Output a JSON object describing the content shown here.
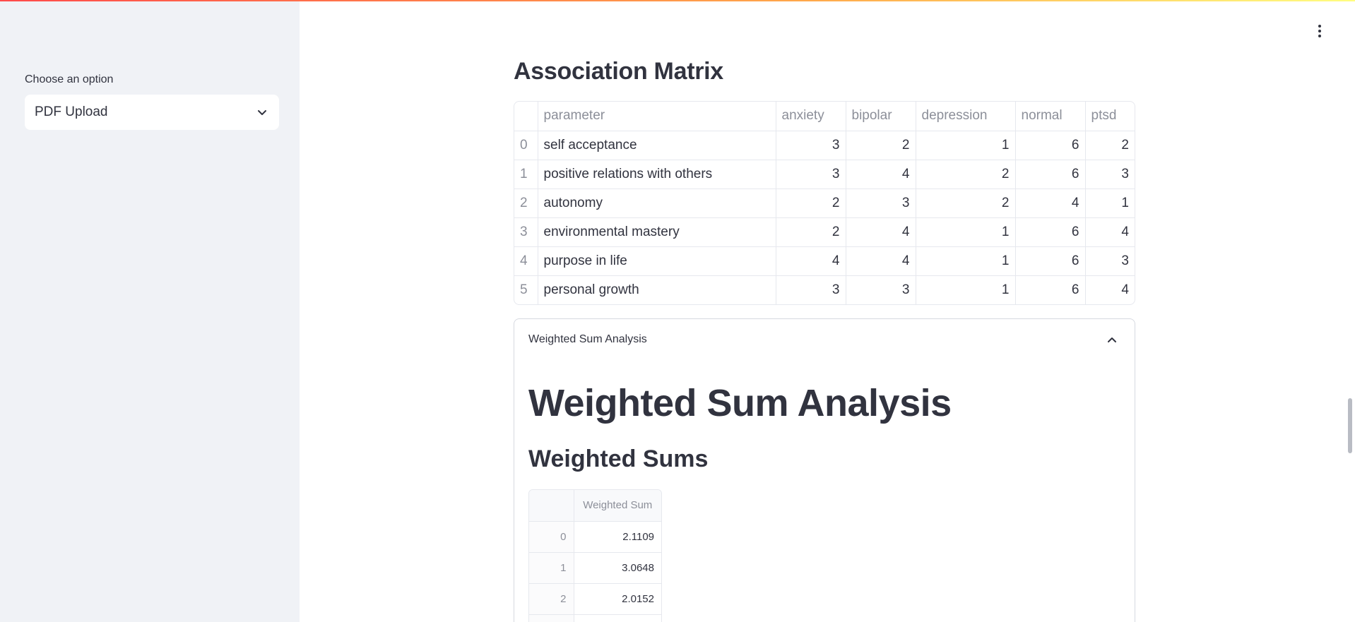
{
  "sidebar": {
    "label": "Choose an option",
    "select_value": "PDF Upload"
  },
  "main": {
    "association_title": "Association Matrix",
    "matrix": {
      "columns": [
        "",
        "parameter",
        "anxiety",
        "bipolar",
        "depression",
        "normal",
        "ptsd"
      ],
      "rows": [
        {
          "idx": "0",
          "parameter": "self acceptance",
          "anxiety": "3",
          "bipolar": "2",
          "depression": "1",
          "normal": "6",
          "ptsd": "2"
        },
        {
          "idx": "1",
          "parameter": "positive relations with others",
          "anxiety": "3",
          "bipolar": "4",
          "depression": "2",
          "normal": "6",
          "ptsd": "3"
        },
        {
          "idx": "2",
          "parameter": "autonomy",
          "anxiety": "2",
          "bipolar": "3",
          "depression": "2",
          "normal": "4",
          "ptsd": "1"
        },
        {
          "idx": "3",
          "parameter": "environmental mastery",
          "anxiety": "2",
          "bipolar": "4",
          "depression": "1",
          "normal": "6",
          "ptsd": "4"
        },
        {
          "idx": "4",
          "parameter": "purpose in life",
          "anxiety": "4",
          "bipolar": "4",
          "depression": "1",
          "normal": "6",
          "ptsd": "3"
        },
        {
          "idx": "5",
          "parameter": "personal growth",
          "anxiety": "3",
          "bipolar": "3",
          "depression": "1",
          "normal": "6",
          "ptsd": "4"
        }
      ]
    },
    "expander": {
      "header": "Weighted Sum Analysis",
      "heading": "Weighted Sum Analysis",
      "subheading": "Weighted Sums",
      "table": {
        "columns": [
          "",
          "Weighted Sum"
        ],
        "rows": [
          {
            "idx": "0",
            "value": "2.1109"
          },
          {
            "idx": "1",
            "value": "3.0648"
          },
          {
            "idx": "2",
            "value": "2.0152"
          }
        ]
      }
    }
  },
  "icons": {
    "select_chevron": "chevron-down-icon",
    "expander_chevron": "chevron-up-icon",
    "menu": "more-vertical-icon"
  }
}
